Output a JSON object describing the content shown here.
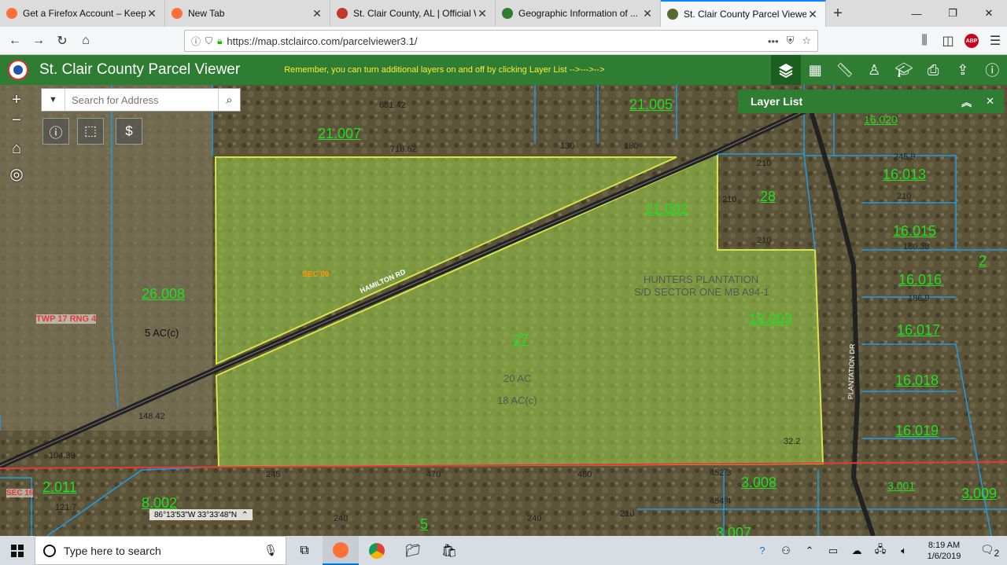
{
  "browser": {
    "tabs": [
      {
        "label": "Get a Firefox Account – Keep yo",
        "favicon_color": "#ff7139",
        "active": false
      },
      {
        "label": "New Tab",
        "favicon_color": "#ff7139",
        "active": false
      },
      {
        "label": "St. Clair County, AL | Official W",
        "favicon_color": "#c0392b",
        "active": false
      },
      {
        "label": "Geographic Information of ... St",
        "favicon_color": "#2e7d32",
        "active": false
      },
      {
        "label": "St. Clair County Parcel Viewer",
        "favicon_color": "#556b2f",
        "active": true
      }
    ],
    "new_tab_icon": "+",
    "url": "https://map.stclairco.com/parcelviewer3.1/",
    "more_icon": "•••",
    "abp_label": "ABP"
  },
  "app": {
    "title": "St. Clair County Parcel Viewer",
    "reminder": "Remember, you can turn additional layers on and off by clicking Layer List -->--->-->",
    "accent_color": "#2e7d32",
    "tools": [
      "layers-icon",
      "basemap-icon",
      "measure-icon",
      "identify-person-icon",
      "education-icon",
      "print-icon",
      "share-icon",
      "info-icon"
    ]
  },
  "search": {
    "placeholder": "Search for Address"
  },
  "layer_list": {
    "title": "Layer List"
  },
  "coordinates": "86°13'53\"W 33°33'48\"N",
  "map_labels": {
    "parcels": [
      "21.007",
      "21.005",
      "21.002",
      "28",
      "16.020",
      "16.013",
      "16.015",
      "16.016",
      "26.008",
      "16.003",
      "27",
      "16.017",
      "16.018",
      "16.019",
      "2.011",
      "8.002",
      "3.008",
      "3.001",
      "3.009",
      "5",
      "3.007",
      "2"
    ],
    "dims": [
      "681.42",
      "716.62",
      "130",
      "180",
      "210",
      "210",
      "210",
      "210",
      "245",
      "470",
      "480",
      "240",
      "240",
      "210",
      "32.2",
      "104.39",
      "148.42",
      "121.7",
      "245.9",
      "180.38",
      "186.9",
      "452.3",
      "454.4"
    ],
    "texts": [
      "SEC 09",
      "HAMILTON RD",
      "HUNTERS PLANTATION",
      "S/D SECTOR ONE MB A94-1",
      "20 AC",
      "18 AC(c)",
      "5 AC(c)",
      "TWP 17  RNG 4",
      "SEC 16",
      "PLANTATION DR"
    ]
  },
  "taskbar": {
    "search_placeholder": "Type here to search",
    "time": "8:19 AM",
    "date": "1/6/2019",
    "notification_count": "2"
  }
}
